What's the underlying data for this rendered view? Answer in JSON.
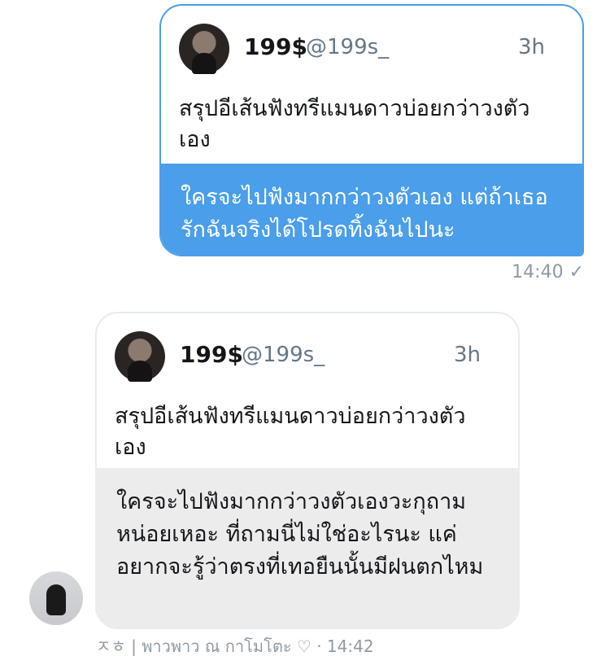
{
  "outgoing": {
    "tweet": {
      "name": "199$",
      "handle": "@199s_",
      "time": "3h",
      "text": "สรุปอีเส้นฟังทรีแมนดาวบ่อยกว่าวงตัวเอง"
    },
    "reply_text": "ใครจะไปฟังมากกว่าวงตัวเอง แต่ถ้าเธอรักฉันจริงได้โปรดทิ้งฉันไปนะ",
    "timestamp": "14:40 ✓"
  },
  "incoming": {
    "tweet": {
      "name": "199$",
      "handle": "@199s_",
      "time": "3h",
      "text": "สรุปอีเส้นฟังทรีแมนดาวบ่อยกว่าวงตัวเอง"
    },
    "reply_text": "ใครจะไปฟังมากกว่าวงตัวเองวะกุถามหน่อยเหอะ ที่ถามนี่ไม่ใช่อะไรนะ แค่อยากจะรู้ว่าตรงที่เทอยืนนั้นมีฝนตกไหม",
    "sender_line": "ㅈㅎ | พาวพาว ณ กาโมโตะ ♡ · 14:42"
  }
}
